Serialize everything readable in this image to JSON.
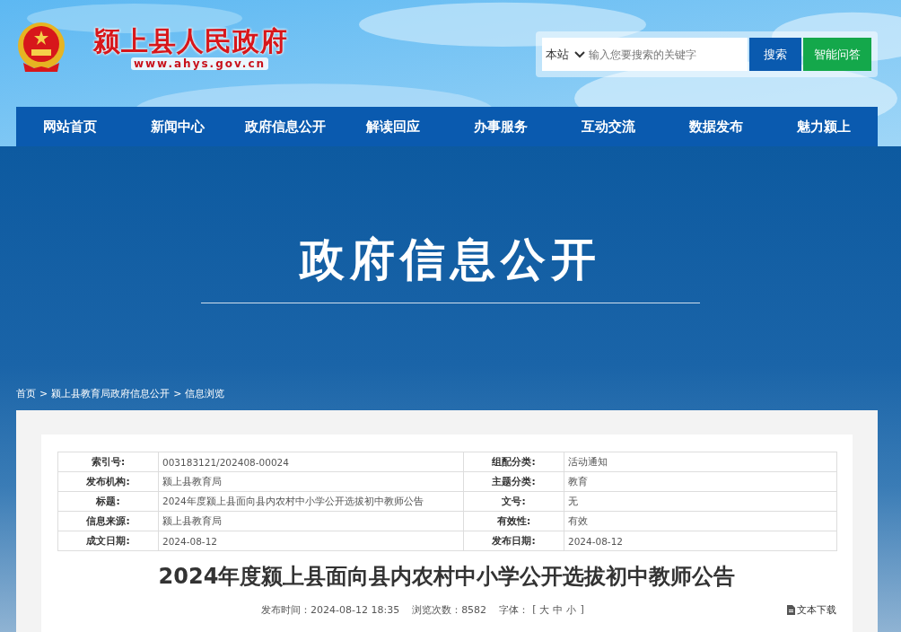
{
  "site": {
    "title": "颍上县人民政府",
    "url": "www.ahys.gov.cn"
  },
  "search": {
    "scope": "本站",
    "placeholder": "输入您要搜索的关键字",
    "buttons": [
      {
        "label": "搜索",
        "kind": "search"
      },
      {
        "label": "智能问答",
        "kind": "assistant"
      }
    ]
  },
  "nav": [
    "网站首页",
    "新闻中心",
    "政府信息公开",
    "解读回应",
    "办事服务",
    "互动交流",
    "数据发布",
    "魅力颍上"
  ],
  "banner": {
    "title": "政府信息公开"
  },
  "breadcrumb": {
    "separator": ">",
    "items": [
      "首页",
      "颍上县教育局政府信息公开",
      "信息浏览"
    ]
  },
  "info_table": [
    {
      "label": "索引号:",
      "value": "003183121/202408-00024",
      "label2": "组配分类:",
      "value2": "活动通知"
    },
    {
      "label": "发布机构:",
      "value": "颍上县教育局",
      "label2": "主题分类:",
      "value2": "教育"
    },
    {
      "label": "标题:",
      "value": "2024年度颍上县面向县内农村中小学公开选拔初中教师公告",
      "label2": "文号:",
      "value2": "无"
    },
    {
      "label": "信息来源:",
      "value": "颍上县教育局",
      "label2": "有效性:",
      "value2": "有效"
    },
    {
      "label": "成文日期:",
      "value": "2024-08-12",
      "label2": "发布日期:",
      "value2": "2024-08-12"
    }
  ],
  "article": {
    "title": "2024年度颍上县面向县内农村中小学公开选拔初中教师公告",
    "publish": "发布时间：2024-08-12 18:35",
    "views": "浏览次数：8582",
    "font_label": "字体：",
    "font_open": "[",
    "font_sizes": [
      "大",
      "中",
      "小"
    ],
    "font_close": "]",
    "download": "文本下载"
  }
}
